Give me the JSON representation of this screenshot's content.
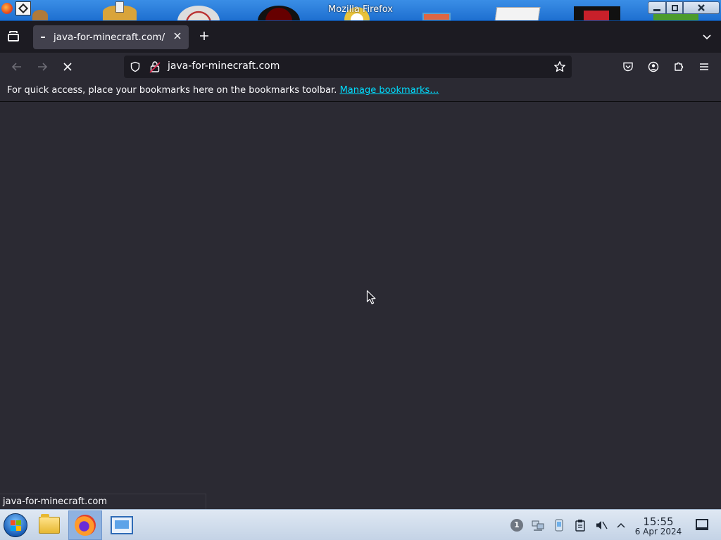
{
  "window": {
    "title": "Mozilla Firefox",
    "controls": {
      "minimize": "minimize",
      "maximize": "maximize",
      "close": "close"
    }
  },
  "tabs": [
    {
      "title": "java-for-minecraft.com/",
      "active": true
    }
  ],
  "nav": {
    "url": "java-for-minecraft.com",
    "loading": true
  },
  "bookmarks_bar": {
    "message": "For quick access, place your bookmarks here on the bookmarks toolbar.",
    "link": "Manage bookmarks…"
  },
  "status": {
    "text": "java-for-minecraft.com"
  },
  "taskbar": {
    "apps": [
      "file-manager-icon",
      "firefox-icon",
      "remote-desktop-icon"
    ],
    "tray_badge": "1",
    "time": "15:55",
    "date": "6 Apr 2024"
  },
  "colors": {
    "toolbar": "#2b2a33",
    "tabstrip": "#1c1b22",
    "active_tab": "#42414d",
    "link": "#00ddff",
    "text": "#fbfbfe"
  }
}
